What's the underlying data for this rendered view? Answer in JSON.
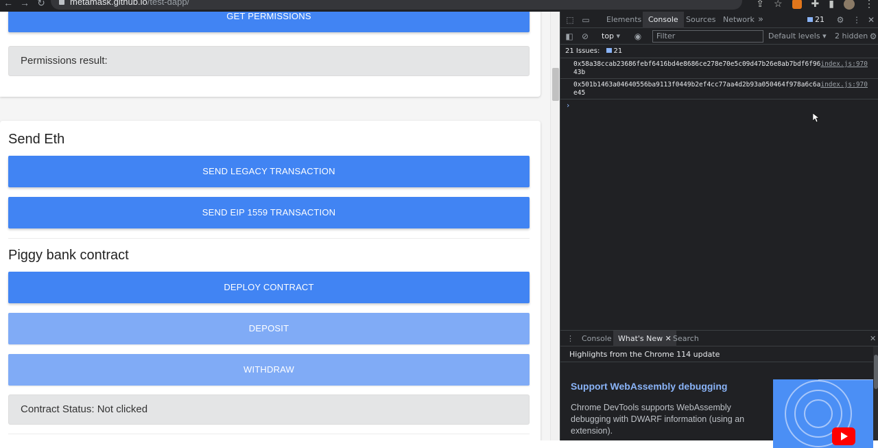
{
  "browser": {
    "url_host": "metamask.github.io",
    "url_path": "/test-dapp/"
  },
  "page": {
    "permissions": {
      "get_button": "GET PERMISSIONS",
      "result_label": "Permissions result:"
    },
    "send_eth": {
      "heading": "Send Eth",
      "legacy_button": "SEND LEGACY TRANSACTION",
      "eip1559_button": "SEND EIP 1559 TRANSACTION"
    },
    "piggy_bank": {
      "heading": "Piggy bank contract",
      "deploy_button": "DEPLOY CONTRACT",
      "deposit_button": "DEPOSIT",
      "withdraw_button": "WITHDRAW",
      "status_label": "Contract Status: Not clicked"
    }
  },
  "devtools": {
    "tabs": [
      "Elements",
      "Console",
      "Sources",
      "Network"
    ],
    "active_tab": "Console",
    "more_tabs": "»",
    "issues_badge": "21",
    "toolbar": {
      "context": "top",
      "filter_placeholder": "Filter",
      "levels": "Default levels",
      "hidden": "2 hidden"
    },
    "issues_bar": {
      "label": "21 Issues:",
      "count": "21"
    },
    "logs": [
      {
        "line1": "0x58a38ccab23686febf6416bd4e8686ce278e70e5c09d47b26e8ab7bdf6f96",
        "line2": "43b",
        "source": "index.js:970"
      },
      {
        "line1": "0x501b1463a04640556ba9113f0449b2ef4cc77aa4d2b93a050464f978a6c6a",
        "line2": "e45",
        "source": "index.js:970"
      }
    ],
    "prompt": "›",
    "drawer": {
      "tabs": [
        "Console",
        "What's New",
        "Search"
      ],
      "active_tab": "What's New",
      "highlights": "Highlights from the Chrome 114 update",
      "feature_title": "Support WebAssembly debugging",
      "feature_body": "Chrome DevTools supports WebAssembly debugging with DWARF information (using an extension)."
    }
  },
  "colors": {
    "primary_button": "#4184f3",
    "disabled_button": "#80abf6",
    "devtools_bg": "#202124",
    "link_blue": "#8ab4f8"
  }
}
